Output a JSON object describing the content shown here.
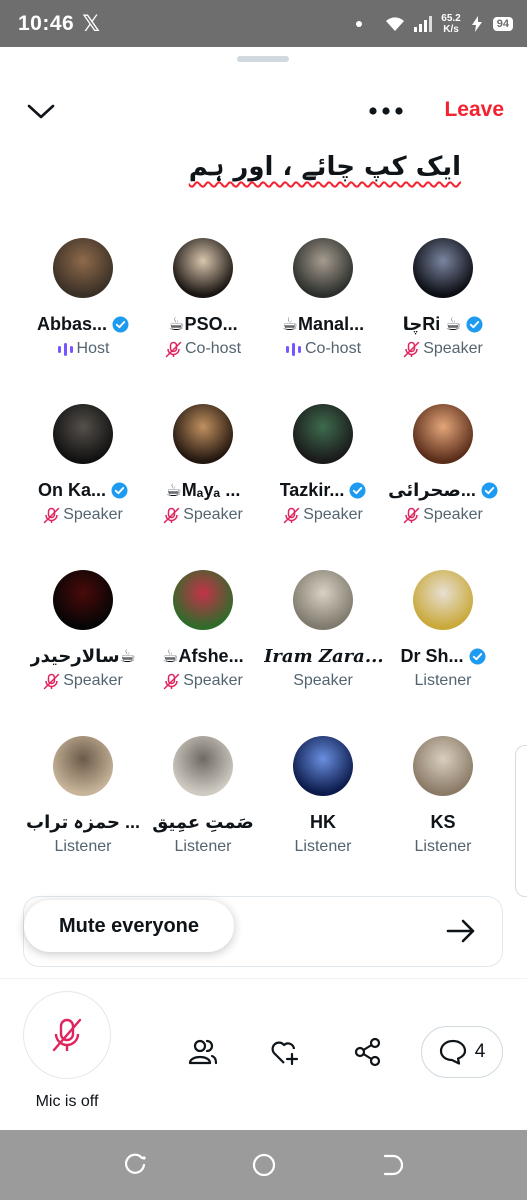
{
  "status_bar": {
    "time": "10:46",
    "x_logo": "𝕏",
    "speed_value": "65.2",
    "speed_unit": "K/s",
    "battery": "94"
  },
  "header": {
    "leave_label": "Leave"
  },
  "space": {
    "title": "ایک کپ چائے ، اور ہم"
  },
  "participants": [
    {
      "name": "Abbas...",
      "verified": true,
      "role": "Host",
      "role_icon": "speaking-bars-icon",
      "avatar_colors": [
        "#3a3026",
        "#8f6a4a"
      ]
    },
    {
      "name": "☕PSO...",
      "verified": false,
      "role": "Co-host",
      "role_icon": "mic-off-icon",
      "avatar_colors": [
        "#1a1512",
        "#d9c6ad"
      ]
    },
    {
      "name": "☕Manal...",
      "verified": false,
      "role": "Co-host",
      "role_icon": "speaking-bars-icon",
      "avatar_colors": [
        "#2b2f2b",
        "#a79c90"
      ]
    },
    {
      "name": "چاRi ☕",
      "verified": true,
      "role": "Speaker",
      "role_icon": "mic-off-icon",
      "avatar_colors": [
        "#0c0e14",
        "#7b85a0"
      ]
    },
    {
      "name": "On Ka...",
      "verified": true,
      "role": "Speaker",
      "role_icon": "mic-off-icon",
      "avatar_colors": [
        "#111111",
        "#55504a"
      ]
    },
    {
      "name": "☕Mₐyₐ ...",
      "verified": false,
      "role": "Speaker",
      "role_icon": "mic-off-icon",
      "avatar_colors": [
        "#23170f",
        "#c09060"
      ]
    },
    {
      "name": "Tazkir...",
      "verified": true,
      "role": "Speaker",
      "role_icon": "mic-off-icon",
      "avatar_colors": [
        "#1a1a1a",
        "#3e6b4e"
      ]
    },
    {
      "name": "صحرائی...",
      "verified": true,
      "role": "Speaker",
      "role_icon": "mic-off-icon",
      "avatar_colors": [
        "#5a2d1a",
        "#e3a67a"
      ]
    },
    {
      "name": "سالارحیدر☕",
      "verified": false,
      "role": "Speaker",
      "role_icon": "mic-off-icon",
      "avatar_colors": [
        "#050505",
        "#4a0a0a"
      ]
    },
    {
      "name": "☕Afshe...",
      "verified": false,
      "role": "Speaker",
      "role_icon": "mic-off-icon",
      "avatar_colors": [
        "#2f6b2a",
        "#c4324a"
      ]
    },
    {
      "name": "Iram Zara...",
      "verified": false,
      "role": "Speaker",
      "role_icon": "none",
      "avatar_colors": [
        "#7f7a6d",
        "#d8d2c4"
      ]
    },
    {
      "name": "Dr Sh...",
      "verified": true,
      "role": "Listener",
      "role_icon": "none",
      "avatar_colors": [
        "#c9a93a",
        "#e7dfd3"
      ]
    },
    {
      "name": "حمزہ تراب ...",
      "verified": false,
      "role": "Listener",
      "role_icon": "none",
      "avatar_colors": [
        "#c7b49a",
        "#6b5a48"
      ]
    },
    {
      "name": "صَمتِ عمِیق",
      "verified": false,
      "role": "Listener",
      "role_icon": "none",
      "avatar_colors": [
        "#cfcac2",
        "#6f6a62"
      ]
    },
    {
      "name": "HK",
      "verified": false,
      "role": "Listener",
      "role_icon": "none",
      "avatar_colors": [
        "#0b1a4a",
        "#6a8fe0"
      ]
    },
    {
      "name": "KS",
      "verified": false,
      "role": "Listener",
      "role_icon": "none",
      "avatar_colors": [
        "#8a7a66",
        "#d9cfc0"
      ]
    }
  ],
  "controls": {
    "mute_everyone_label": "Mute everyone",
    "mic_label": "Mic is off",
    "comments_count": "4"
  },
  "colors": {
    "accent_red": "#f4212e",
    "mic_off_pink": "#e0245e",
    "verified_blue": "#1d9bf0",
    "speaking_purple": "#7856ff"
  }
}
